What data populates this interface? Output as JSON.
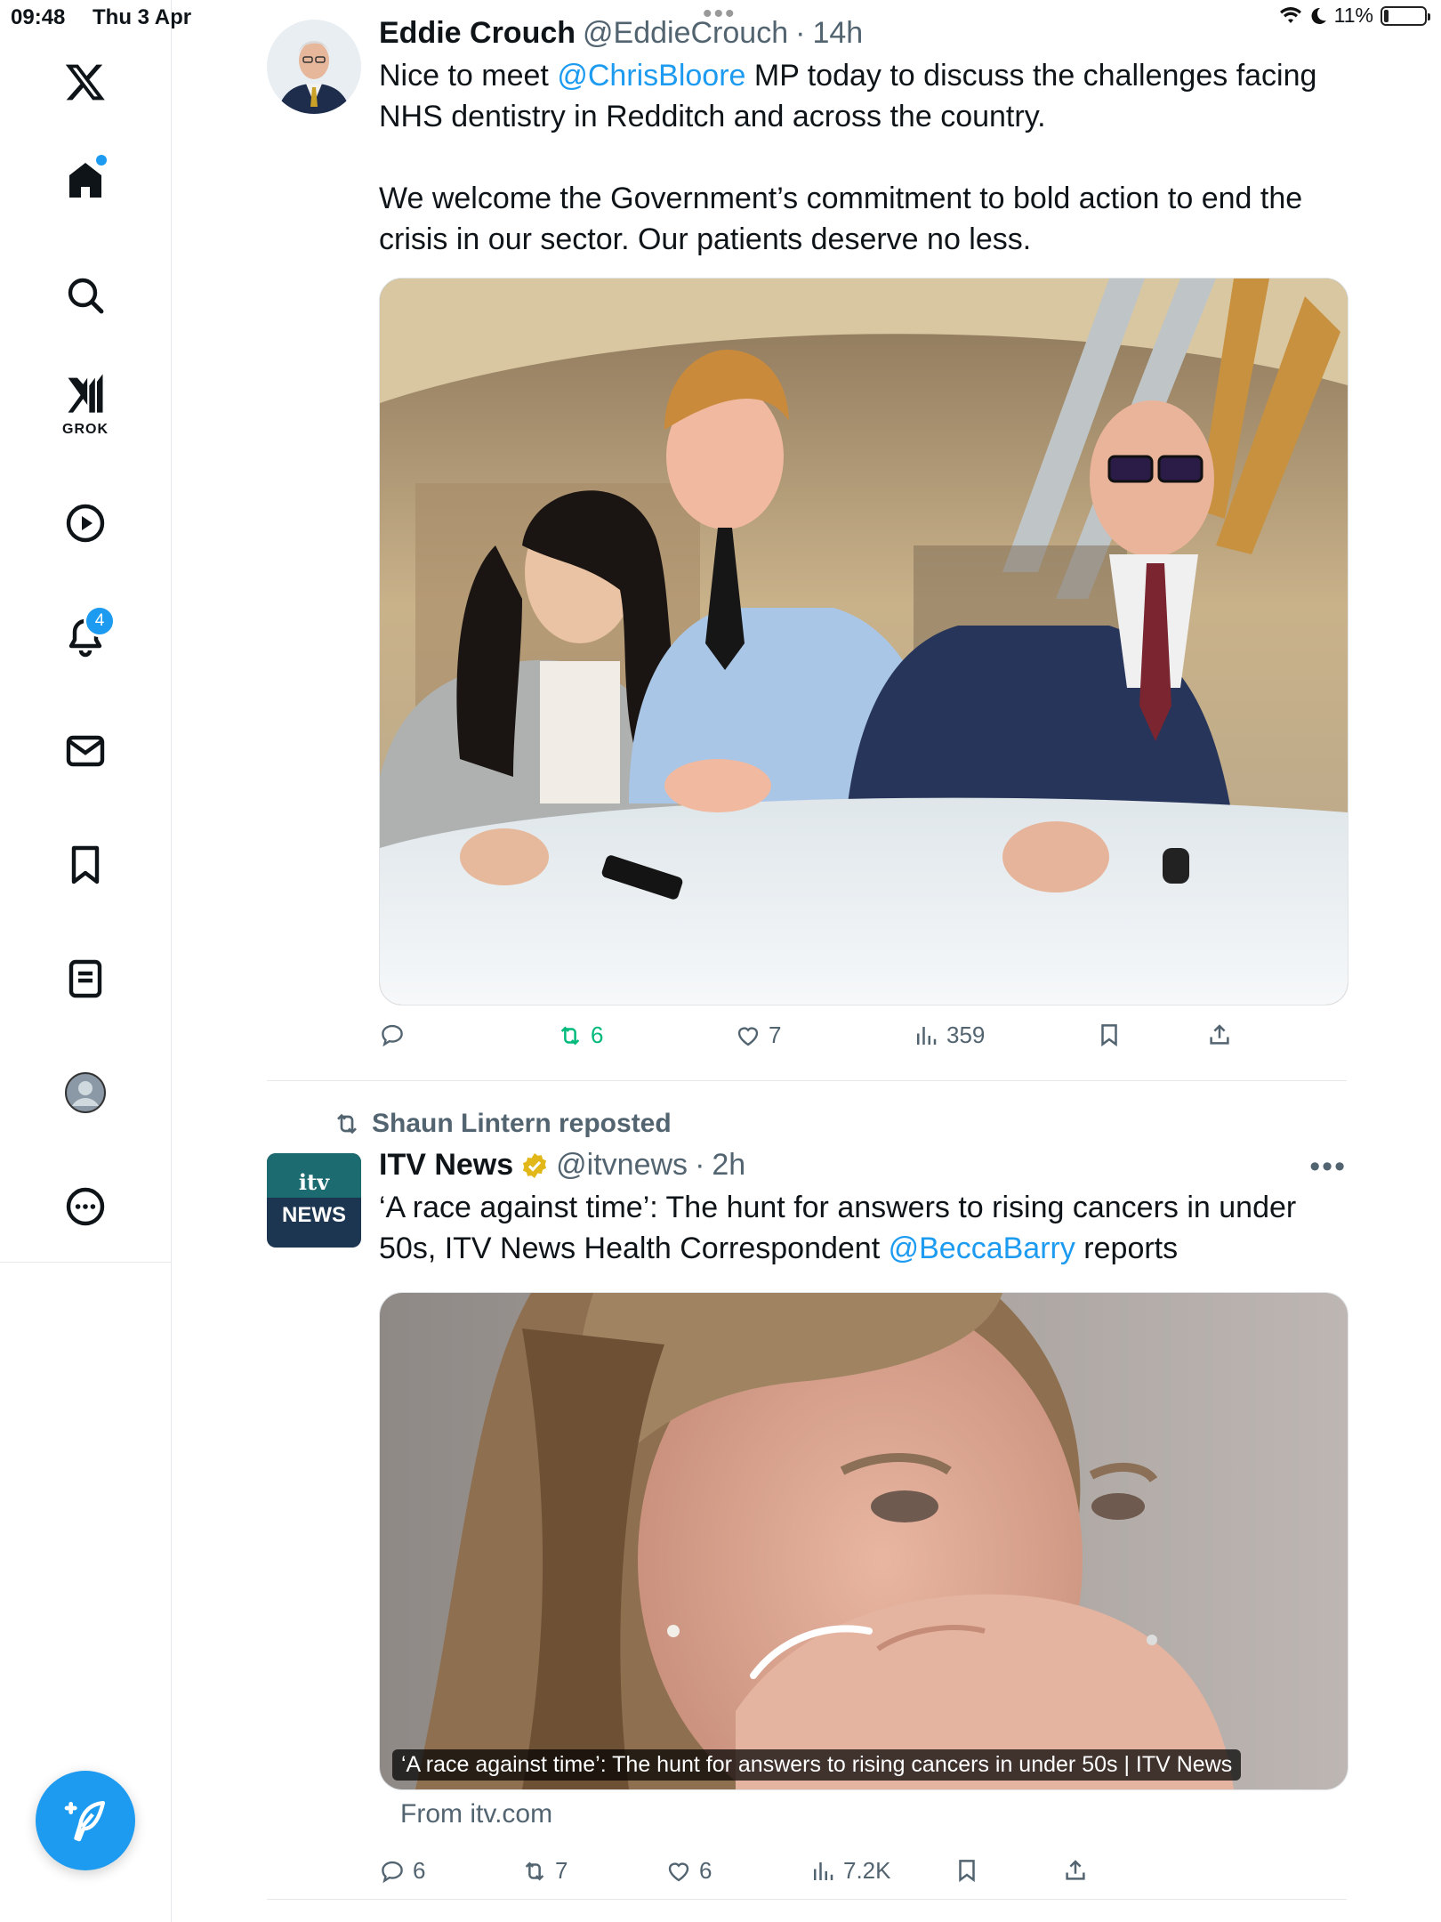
{
  "status_bar": {
    "time": "09:48",
    "date": "Thu 3 Apr",
    "battery": "11%",
    "battery_level": 0.11,
    "dots": "•••"
  },
  "sidebar": {
    "grok_label": "GROK",
    "notifications_count": "4",
    "items": [
      "x-logo",
      "home",
      "search",
      "grok",
      "video",
      "notifications",
      "messages",
      "bookmarks",
      "lists",
      "profile",
      "more"
    ]
  },
  "tweets": [
    {
      "name": "Eddie Crouch",
      "handle": "@EddieCrouch",
      "sep": "·",
      "time": "14h",
      "text_p1_a": "Nice to meet ",
      "mention": "@ChrisBloore",
      "text_p1_b": " MP today to discuss the challenges facing NHS dentistry in Redditch and across the country.",
      "text_p2": "We welcome the Government’s commitment to bold action to end the crisis in our sector. Our patients deserve no less.",
      "stats": {
        "reposts": "6",
        "likes": "7",
        "views": "359"
      }
    },
    {
      "repost_label": "Shaun Lintern reposted",
      "avatar_logo_top": "itv",
      "avatar_logo_bottom": "NEWS",
      "name": "ITV News",
      "handle": "@itvnews",
      "sep": "·",
      "time": "2h",
      "text_a": "‘A race against time’: The hunt for answers to rising cancers in under 50s, ITV News Health Correspondent ",
      "mention": "@BeccaBarry",
      "text_b": " reports",
      "card_caption": "‘A race against time’: The hunt for answers to rising cancers in under 50s | ITV News",
      "card_source": "From itv.com",
      "stats": {
        "replies": "6",
        "reposts": "7",
        "likes": "6",
        "views": "7.2K"
      },
      "more": "•••"
    }
  ],
  "colors": {
    "accent": "#1d9bf0",
    "repost_green": "#00ba7c",
    "secondary": "#536471",
    "itv_teal": "#1b6b70"
  }
}
